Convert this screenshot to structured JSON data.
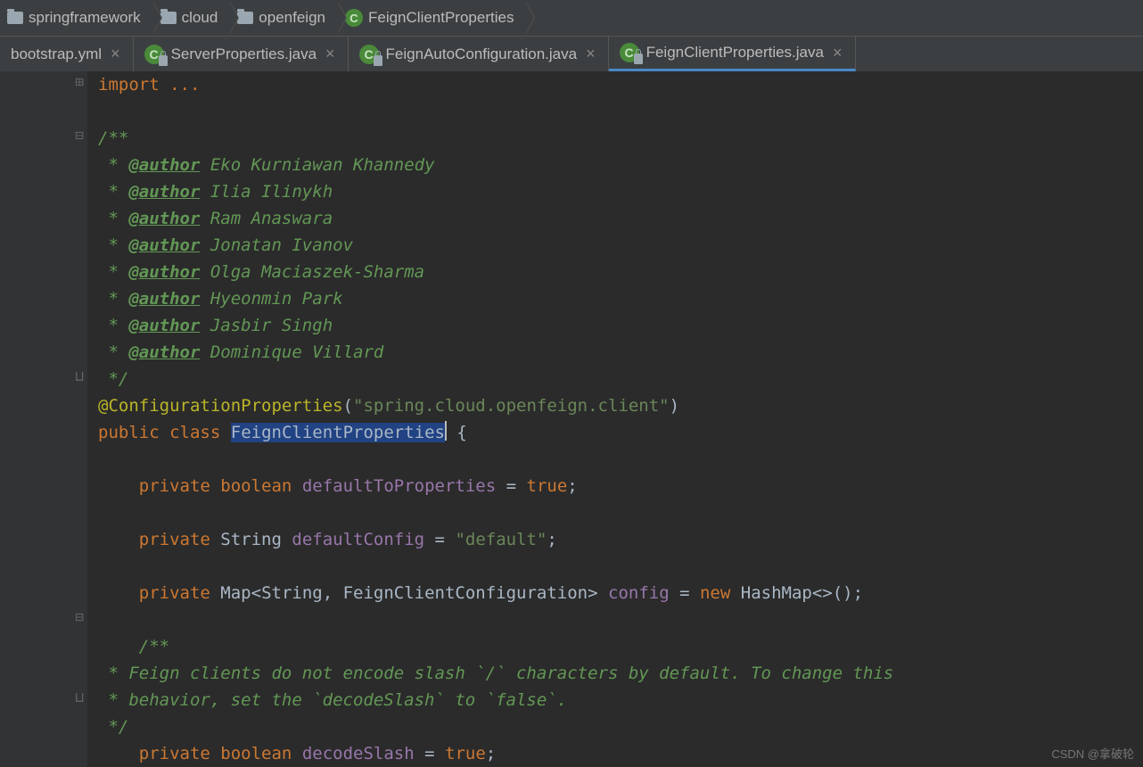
{
  "breadcrumb": [
    {
      "label": "springframework",
      "icon": "folder"
    },
    {
      "label": "cloud",
      "icon": "folder"
    },
    {
      "label": "openfeign",
      "icon": "folder"
    },
    {
      "label": "FeignClientProperties",
      "icon": "class"
    }
  ],
  "tabs": [
    {
      "label": "bootstrap.yml",
      "icon": "none",
      "active": false,
      "lock": false
    },
    {
      "label": "ServerProperties.java",
      "icon": "class",
      "active": false,
      "lock": true
    },
    {
      "label": "FeignAutoConfiguration.java",
      "icon": "class",
      "active": false,
      "lock": true
    },
    {
      "label": "FeignClientProperties.java",
      "icon": "class",
      "active": true,
      "lock": true
    }
  ],
  "code": {
    "importLine": "import ...",
    "docOpen": "/**",
    "authors": [
      "Eko Kurniawan Khannedy",
      "Ilia Ilinykh",
      "Ram Anaswara",
      "Jonatan Ivanov",
      "Olga Maciaszek-Sharma",
      "Hyeonmin Park",
      "Jasbir Singh",
      "Dominique Villard"
    ],
    "authorTag": "@author",
    "docClose": " */",
    "annotation": "@ConfigurationProperties",
    "annotationArg": "\"spring.cloud.openfeign.client\"",
    "public": "public",
    "class": "class",
    "className": "FeignClientProperties",
    "openBrace": " {",
    "private": "private",
    "boolean": "boolean",
    "string": "String",
    "map": "Map",
    "new": "new",
    "true": "true",
    "field1": "defaultToProperties",
    "field2": "defaultConfig",
    "field2val": "\"default\"",
    "genericOpen": "<String, FeignClientConfiguration>",
    "field3": "config",
    "hashmap": "HashMap<>()",
    "doc2open": "/**",
    "doc2l1": " * Feign clients do not encode slash `/` characters by default. To change this",
    "doc2l2": " * behavior, set the `decodeSlash` to `false`.",
    "doc2close": " */",
    "field4": "decodeSlash"
  },
  "watermark": "CSDN @拿破轮"
}
